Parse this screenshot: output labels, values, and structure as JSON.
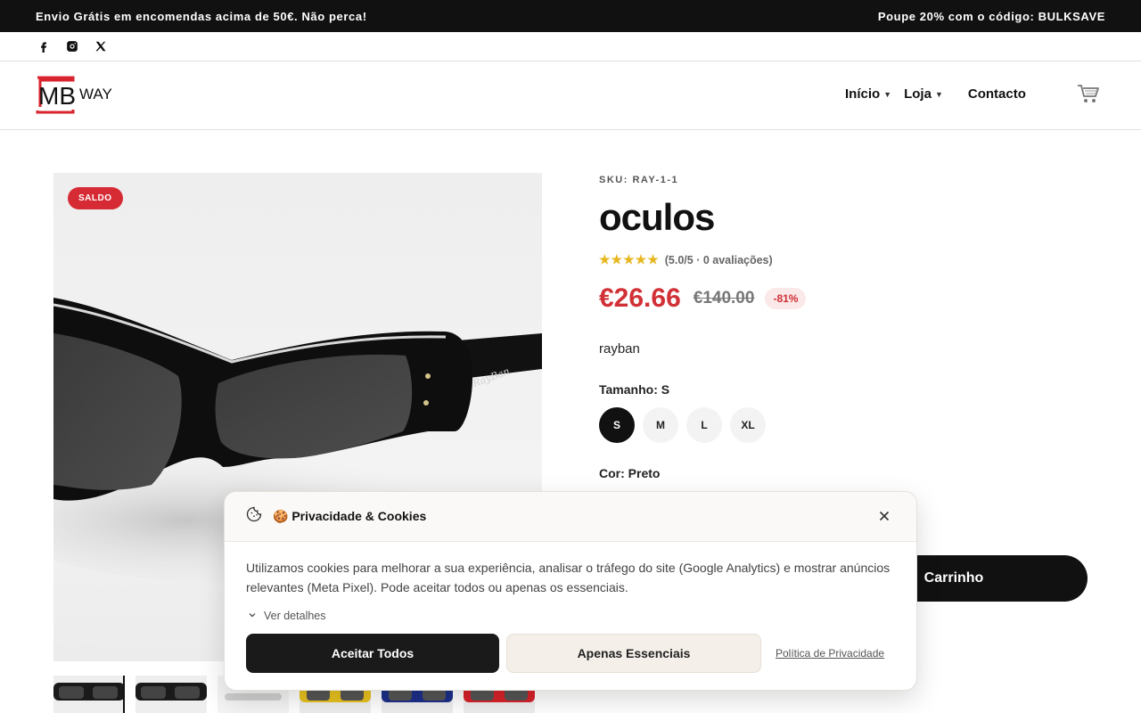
{
  "announcement": {
    "left": "Envio Grátis em encomendas acima de 50€. Não perca!",
    "right": "Poupe 20% com o código: BULKSAVE"
  },
  "social": {
    "icons": [
      "facebook-icon",
      "instagram-icon",
      "x-icon"
    ]
  },
  "header": {
    "logo_text": "MB",
    "logo_sub": "WAY",
    "nav": [
      {
        "label": "Início",
        "has_dropdown": true
      },
      {
        "label": "Loja",
        "has_dropdown": true
      },
      {
        "label": "Contacto",
        "has_dropdown": false
      }
    ],
    "cart_icon": "cart-icon"
  },
  "product": {
    "badge": "SALDO",
    "sku": "SKU: RAY-1-1",
    "title": "oculos",
    "rating_value": 5.0,
    "rating_text": "(5.0/5 · 0 avaliações)",
    "price_now": "€26.66",
    "price_old": "€140.00",
    "discount": "-81%",
    "brand": "rayban",
    "size_label": "Tamanho: S",
    "sizes": [
      "S",
      "M",
      "L",
      "XL"
    ],
    "selected_size": "S",
    "color_label": "Cor: Preto",
    "add_to_cart": "Carrinho",
    "thumbnails": [
      "black",
      "black",
      "grey",
      "yellow",
      "blue",
      "red"
    ]
  },
  "cookie": {
    "title": "🍪 Privacidade & Cookies",
    "body": "Utilizamos cookies para melhorar a sua experiência, analisar o tráfego do site (Google Analytics) e mostrar anúncios relevantes (Meta Pixel). Pode aceitar todos ou apenas os essenciais.",
    "details": "Ver detalhes",
    "accept": "Aceitar Todos",
    "essential": "Apenas Essenciais",
    "policy": "Política de Privacidade"
  },
  "colors": {
    "accent_red": "#d13036",
    "dark": "#111111",
    "star": "#e7b721",
    "logo_red": "#d9232e"
  }
}
